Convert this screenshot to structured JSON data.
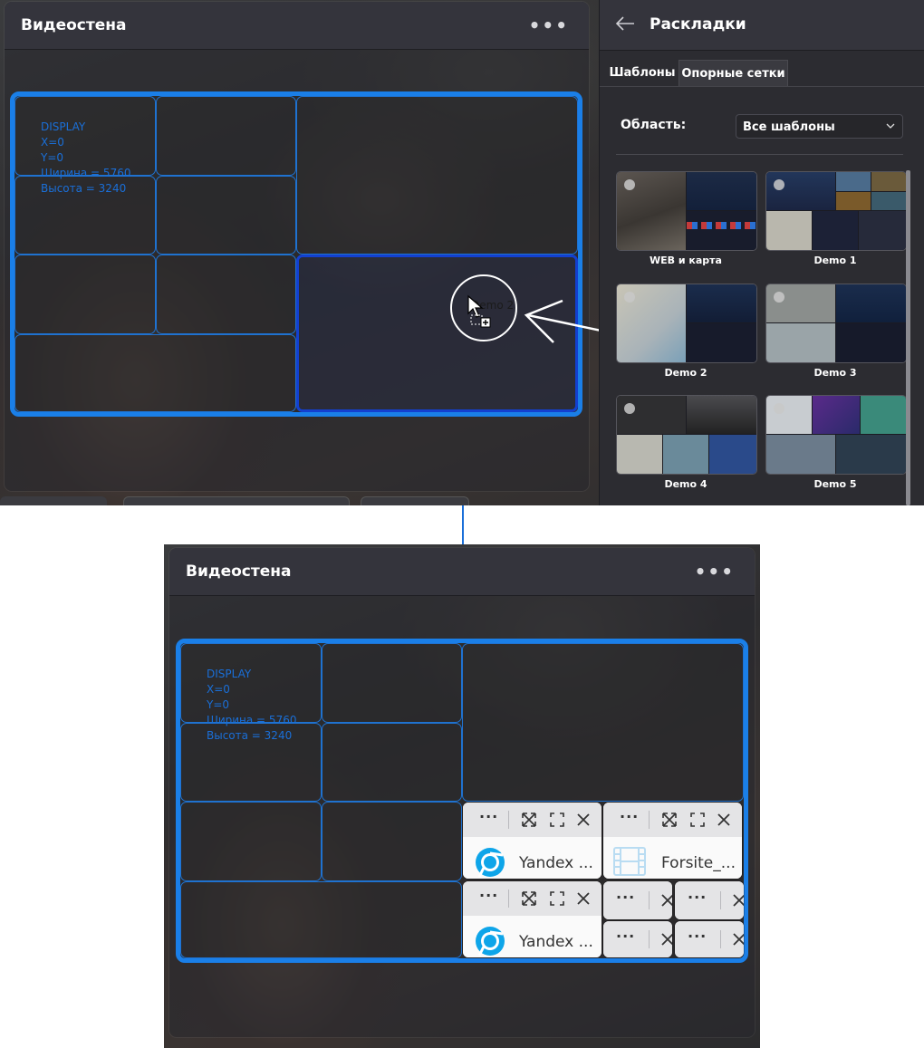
{
  "top": {
    "videowall": {
      "title": "Видеостена",
      "menu_label": "•••",
      "display_info": "DISPLAY\nX=0\nY=0\nШирина = 5760\nВысота = 3240"
    },
    "layouts_panel": {
      "title": "Раскладки",
      "tabs": [
        {
          "label": "Шаблоны",
          "active": true
        },
        {
          "label": "Опорные сетки",
          "active": false
        }
      ],
      "area_label": "Область:",
      "area_select_value": "Все шаблоны",
      "templates": [
        {
          "label": "WEB и карта"
        },
        {
          "label": "Demo 1"
        },
        {
          "label": "Demo 2"
        },
        {
          "label": "Demo 3"
        },
        {
          "label": "Demo 4"
        },
        {
          "label": "Demo 5"
        }
      ]
    },
    "drag_preview_label": "Demo 2"
  },
  "bottom": {
    "videowall": {
      "title": "Видеостена",
      "menu_label": "•••",
      "display_info": "DISPLAY\nX=0\nY=0\nШирина = 5760\nВысота = 3240"
    },
    "tiles": [
      {
        "name": "Yandex ...",
        "icon": "chrome-icon"
      },
      {
        "name": "Forsite_...",
        "icon": "film-icon"
      },
      {
        "name": "Yandex ...",
        "icon": "chrome-icon"
      }
    ],
    "tile_menu_label": "···"
  },
  "colors": {
    "accent_blue": "#1a7fe8",
    "panel_header": "#34343c",
    "grid_line": "#1f72d0"
  }
}
